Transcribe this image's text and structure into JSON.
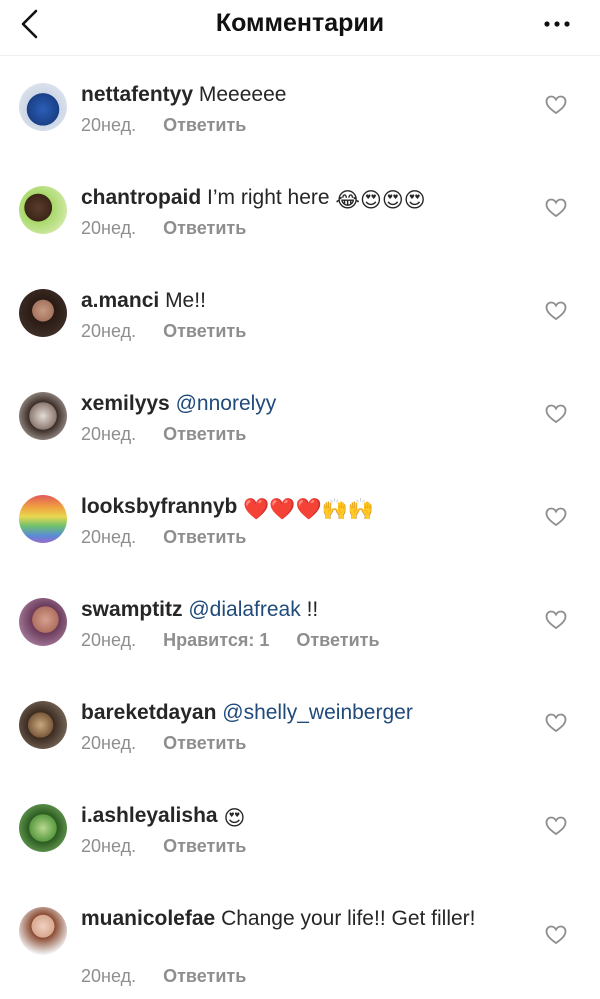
{
  "header": {
    "title": "Комментарии"
  },
  "comments": [
    {
      "username": "nettafentyy",
      "text": "Meeeeee",
      "time": "20нед.",
      "reply": "Ответить"
    },
    {
      "username": "chantropaid",
      "text": "I’m right here",
      "emojis": [
        "😂",
        "😍",
        "😍",
        "😍"
      ],
      "time": "20нед.",
      "reply": "Ответить"
    },
    {
      "username": "a.manci",
      "text": "Me!!",
      "time": "20нед.",
      "reply": "Ответить"
    },
    {
      "username": "xemilyys",
      "mention": "@nnorelyy",
      "time": "20нед.",
      "reply": "Ответить"
    },
    {
      "username": "looksbyfrannyb",
      "emojis": [
        "❤️",
        "❤️",
        "❤️",
        "🙌",
        "🙌"
      ],
      "time": "20нед.",
      "reply": "Ответить"
    },
    {
      "username": "swamptitz",
      "mention": "@dialafreak",
      "text": "!!",
      "time": "20нед.",
      "likes": "Нравится: 1",
      "reply": "Ответить"
    },
    {
      "username": "bareketdayan",
      "mention": "@shelly_weinberger",
      "time": "20нед.",
      "reply": "Ответить"
    },
    {
      "username": "i.ashleyalisha",
      "emojis": [
        "😍"
      ],
      "time": "20нед.",
      "reply": "Ответить"
    },
    {
      "username": "muanicolefae",
      "text": "Change your life!! Get filler!",
      "time": "20нед.",
      "reply": "Ответить"
    }
  ]
}
